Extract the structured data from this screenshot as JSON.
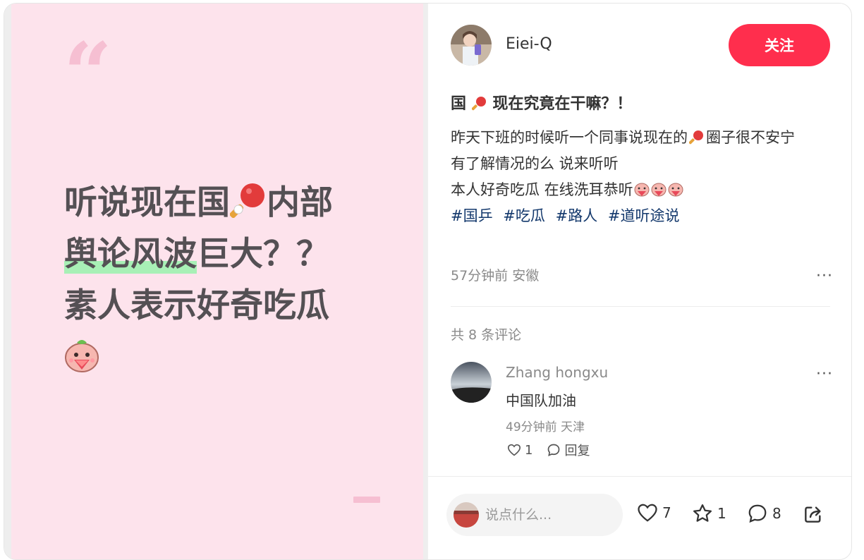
{
  "cover": {
    "line1": "听说现在国",
    "line1b": "内部",
    "line2_highlight": "舆论风波",
    "line2_rest": "巨大？？",
    "line3": "素人表示好奇吃瓜"
  },
  "post": {
    "author": "Eiei-Q",
    "follow_label": "关注",
    "title_pre": "国",
    "title_post": "现在究竟在干嘛？！",
    "body_line1_pre": "昨天下班的时候听一个同事说现在的",
    "body_line1_post": "圈子很不安宁",
    "body_line2": "有了解情况的么 说来听听",
    "body_line3": "本人好奇吃瓜 在线洗耳恭听",
    "tags": [
      "#国乒",
      "#吃瓜",
      "#路人",
      "#道听途说"
    ],
    "meta": "57分钟前 安徽",
    "more": "···"
  },
  "comments": {
    "count_label": "共 8 条评论",
    "items": [
      {
        "name": "Zhang hongxu",
        "text": "中国队加油",
        "meta": "49分钟前 天津",
        "likes": "1",
        "reply_label": "回复",
        "more": "···"
      }
    ]
  },
  "footer": {
    "input_placeholder": "说点什么...",
    "likes": "7",
    "stars": "1",
    "comments": "8"
  },
  "colors": {
    "accent": "#ff2e4d",
    "cover_bg": "#fde3ec",
    "highlight": "#a8f0b6",
    "tag": "#13386c"
  }
}
